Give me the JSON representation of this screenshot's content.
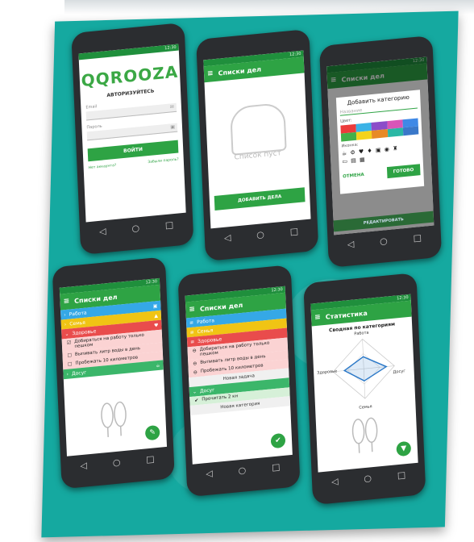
{
  "login": {
    "status_time": "12:30",
    "logo_text": "QQROOZA",
    "caption": "АВТОРИЗУЙТЕСЬ",
    "email_label": "Email",
    "password_label": "Пароль",
    "login_button": "ВОЙТИ",
    "register_link": "Нет аккаунта?",
    "forgot_link": "Забыли пароль?"
  },
  "empty": {
    "status_time": "12:30",
    "title": "Списки дел",
    "empty_text": "Список пуст",
    "add_button": "ДОБАВИТЬ ДЕЛА"
  },
  "dialog": {
    "status_time": "12:30",
    "bg_title": "Списки дел",
    "title": "Добавить категорию",
    "name_placeholder": "Название",
    "color_label": "Цвет:",
    "icon_label": "Иконка:",
    "icons": "☕ ⚙ ♥ ♦ ▣ ◉ ♜",
    "icons2": "▭ ▤ ▦",
    "cancel": "ОТМЕНА",
    "done": "ГОТОВО",
    "edit_bar": "РЕДАКТИРОВАТЬ",
    "colors": [
      "#ec3b3b",
      "#3bb3e6",
      "#8c4dc9",
      "#d955b8",
      "#3f89e6",
      "#43b04a",
      "#f4d31b",
      "#e88a25",
      "#2ab8a5",
      "#3a78c9"
    ]
  },
  "lists": {
    "status_time": "12:30",
    "title": "Списки дел",
    "categories": [
      {
        "name": "Работа",
        "color": "#35a8e6",
        "icon": "▣"
      },
      {
        "name": "Семья",
        "color": "#f0c414",
        "icon": "▲"
      },
      {
        "name": "Здоровье",
        "color": "#e94c4c",
        "icon": "♥"
      }
    ],
    "tasks": [
      "Добираться на работу только пешком",
      "Выпивать литр воды в день",
      "Пробежать 10 километров"
    ],
    "leisure": {
      "name": "Досуг",
      "color": "#3bb66a",
      "icon": "☕"
    }
  },
  "edit": {
    "status_time": "12:30",
    "title": "Списки дел",
    "categories": [
      {
        "name": "Работа",
        "color": "#35a8e6"
      },
      {
        "name": "Семья",
        "color": "#f0c414"
      },
      {
        "name": "Здоровье",
        "color": "#e94c4c"
      }
    ],
    "tasks": [
      "Добираться на работу только пешком",
      "Выпивать литр воды в день",
      "Пробежать 10 километров"
    ],
    "new_task": "Новая задача",
    "leisure": "Досуг",
    "leisure_task": "Прочитать 2 кн",
    "new_category": "Новая категория"
  },
  "stats": {
    "status_time": "12:30",
    "title": "Статистика",
    "chart_title": "Сводная по категориям",
    "labels": {
      "top": "Работа",
      "left": "Здоровье",
      "right": "Досуг",
      "bottom": "Семья"
    }
  }
}
